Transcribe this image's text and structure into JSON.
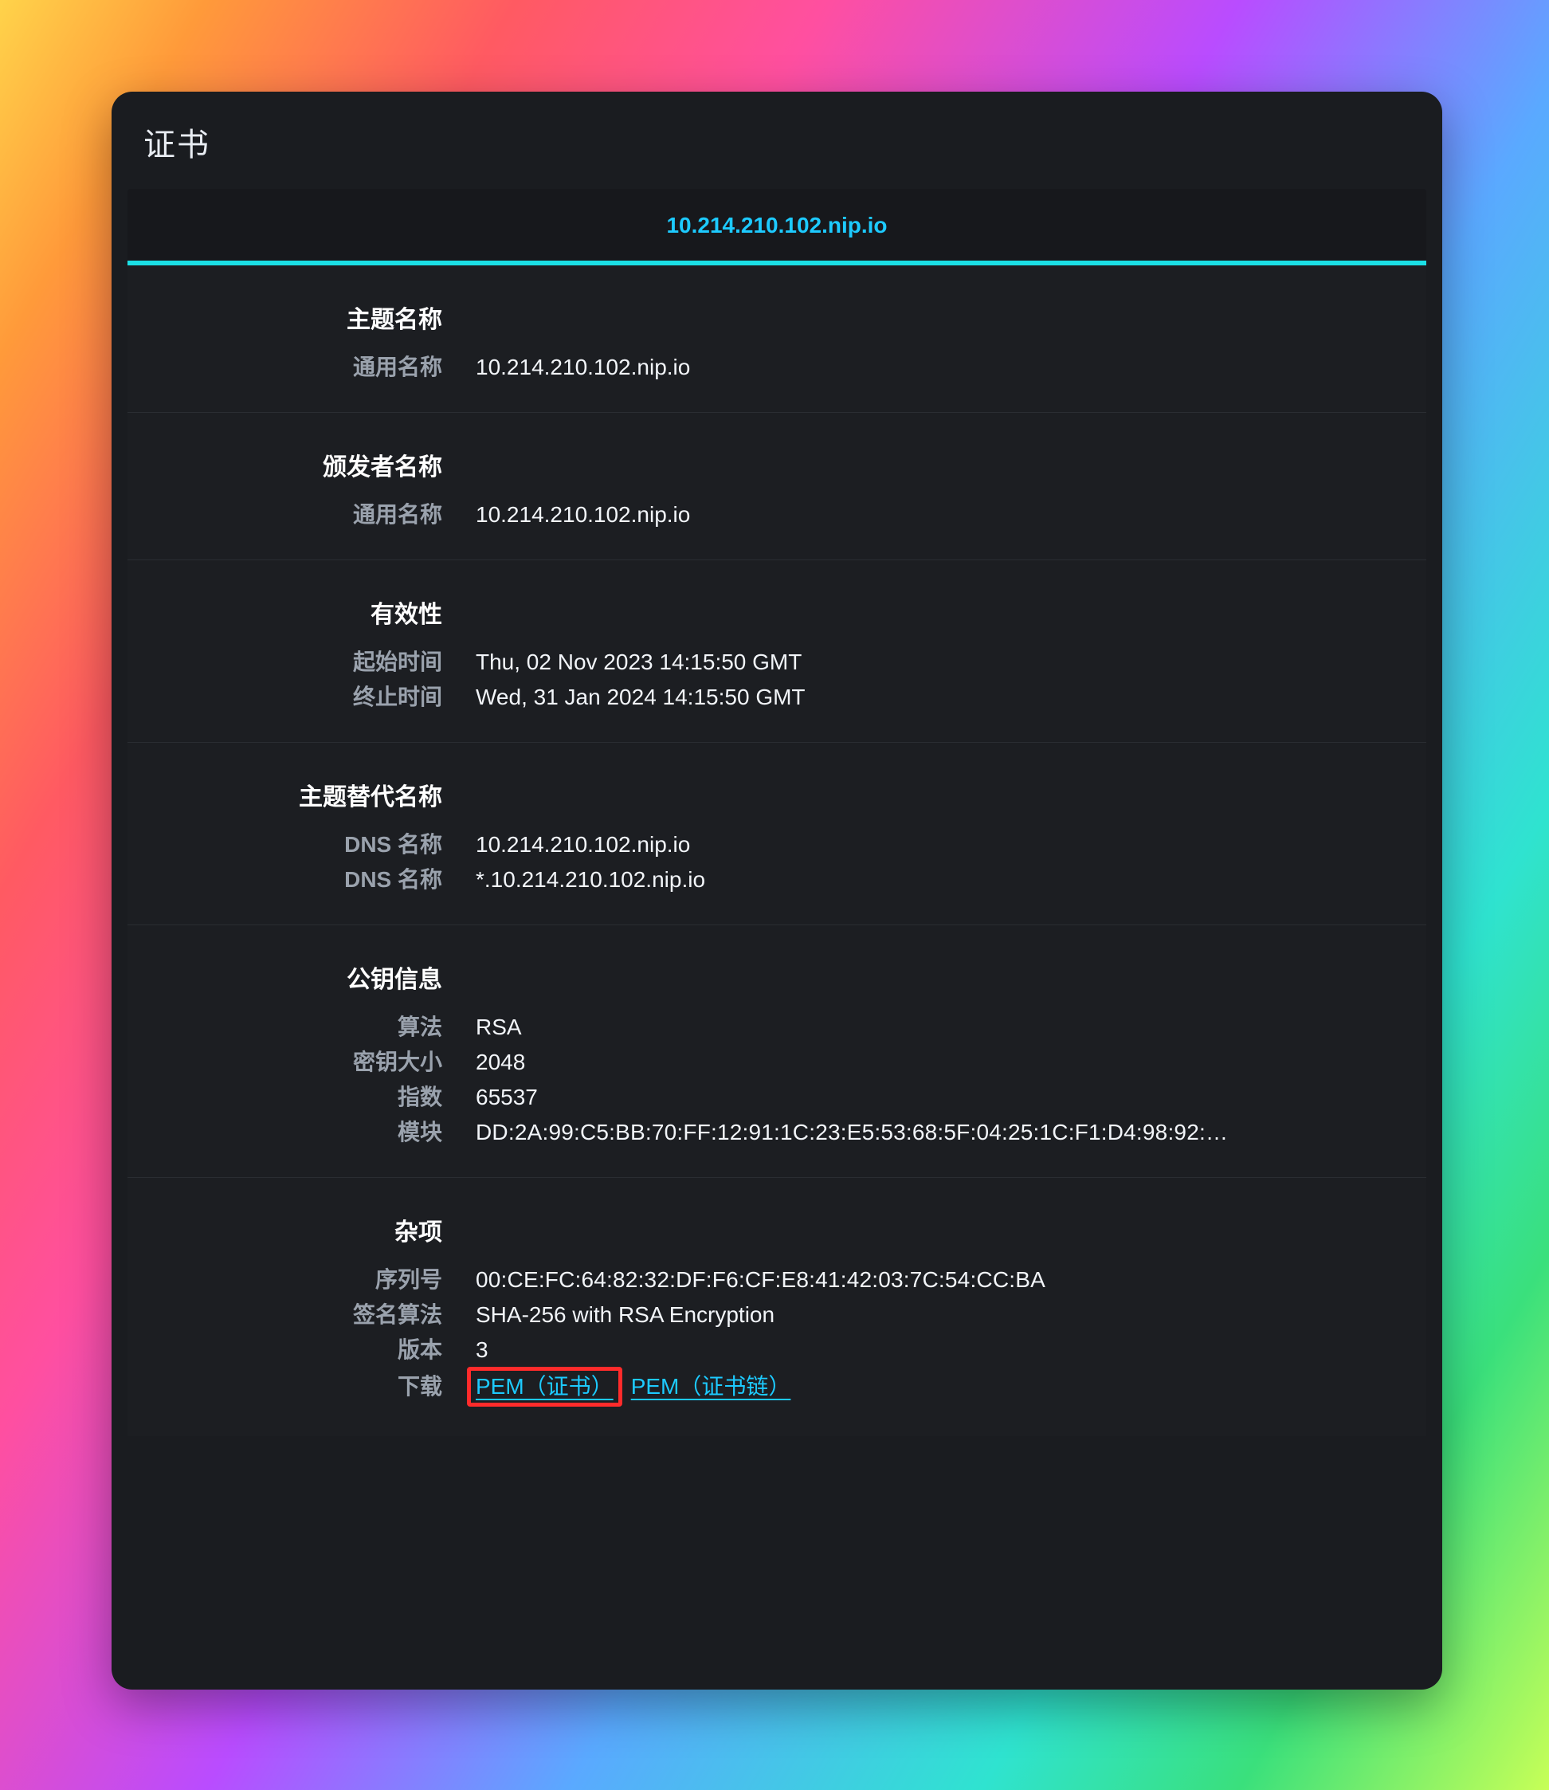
{
  "accent": "#1dcaff",
  "title": "证书",
  "tab": {
    "label": "10.214.210.102.nip.io"
  },
  "sections": {
    "subject": {
      "header": "主题名称",
      "rows": [
        {
          "label": "通用名称",
          "value": "10.214.210.102.nip.io"
        }
      ]
    },
    "issuer": {
      "header": "颁发者名称",
      "rows": [
        {
          "label": "通用名称",
          "value": "10.214.210.102.nip.io"
        }
      ]
    },
    "validity": {
      "header": "有效性",
      "rows": [
        {
          "label": "起始时间",
          "value": "Thu, 02 Nov 2023 14:15:50 GMT"
        },
        {
          "label": "终止时间",
          "value": "Wed, 31 Jan 2024 14:15:50 GMT"
        }
      ]
    },
    "san": {
      "header": "主题替代名称",
      "rows": [
        {
          "label": "DNS 名称",
          "value": "10.214.210.102.nip.io"
        },
        {
          "label": "DNS 名称",
          "value": "*.10.214.210.102.nip.io"
        }
      ]
    },
    "pubkey": {
      "header": "公钥信息",
      "rows": [
        {
          "label": "算法",
          "value": "RSA"
        },
        {
          "label": "密钥大小",
          "value": "2048"
        },
        {
          "label": "指数",
          "value": "65537"
        },
        {
          "label": "模块",
          "value": "DD:2A:99:C5:BB:70:FF:12:91:1C:23:E5:53:68:5F:04:25:1C:F1:D4:98:92:…"
        }
      ]
    },
    "misc": {
      "header": "杂项",
      "rows": [
        {
          "label": "序列号",
          "value": "00:CE:FC:64:82:32:DF:F6:CF:E8:41:42:03:7C:54:CC:BA"
        },
        {
          "label": "签名算法",
          "value": "SHA-256 with RSA Encryption"
        },
        {
          "label": "版本",
          "value": "3"
        }
      ],
      "download": {
        "label": "下载",
        "pem_cert": "PEM（证书）",
        "pem_chain": "PEM（证书链）"
      }
    }
  }
}
